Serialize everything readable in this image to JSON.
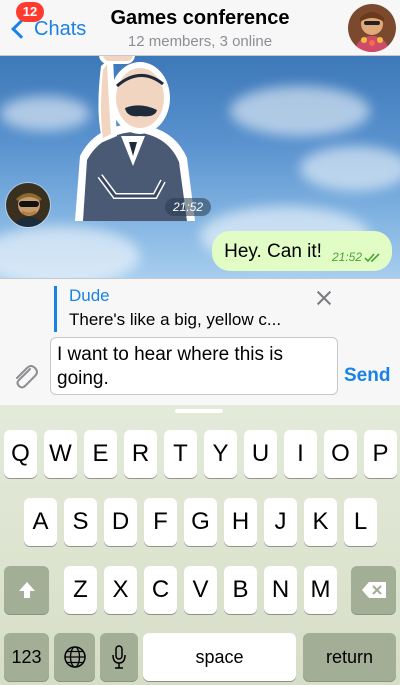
{
  "header": {
    "back_label": "Chats",
    "unread_badge": "12",
    "title": "Games conference",
    "subtitle": "12 members, 3 online"
  },
  "messages": {
    "sticker_time": "21:52",
    "outgoing_text": "Hey. Can it!",
    "outgoing_time": "21:52",
    "outgoing_status": "read"
  },
  "reply": {
    "name": "Dude",
    "text": "There's like a big, yellow c..."
  },
  "composer": {
    "input_value": "I want to hear where this is going.",
    "send_label": "Send"
  },
  "keyboard": {
    "row1": [
      "Q",
      "W",
      "E",
      "R",
      "T",
      "Y",
      "U",
      "I",
      "O",
      "P"
    ],
    "row2": [
      "A",
      "S",
      "D",
      "F",
      "G",
      "H",
      "J",
      "K",
      "L"
    ],
    "row3": [
      "Z",
      "X",
      "C",
      "V",
      "B",
      "N",
      "M"
    ],
    "numbers_label": "123",
    "space_label": "space",
    "return_label": "return"
  },
  "colors": {
    "accent": "#1a82e6",
    "badge": "#ff3b30",
    "outgoing_bubble": "#e2fcc6",
    "keyboard_dark_key": "#a3ae97"
  }
}
